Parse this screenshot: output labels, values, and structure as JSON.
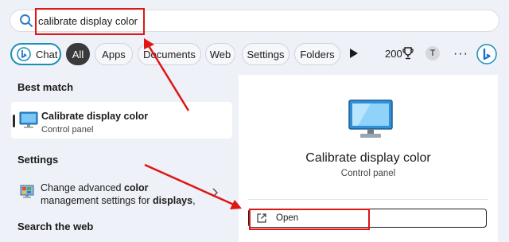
{
  "search": {
    "value": "calibrate display color"
  },
  "filters": {
    "chat": "Chat",
    "all": "All",
    "apps": "Apps",
    "documents": "Documents",
    "web": "Web",
    "settings": "Settings",
    "folders": "Folders"
  },
  "toolbar": {
    "rewards_count": "200",
    "avatar_initial": "T",
    "more_options": "···"
  },
  "left_panel": {
    "best_match_label": "Best match",
    "best_match": {
      "title": "Calibrate display color",
      "subtitle": "Control panel"
    },
    "settings_label": "Settings",
    "settings_item": {
      "text_1": "Change advanced ",
      "bold_1": "color",
      "text_2": " management settings for ",
      "bold_2": "displays",
      "text_3": ","
    },
    "search_web_label": "Search the web"
  },
  "detail": {
    "title": "Calibrate display color",
    "subtitle": "Control panel",
    "open_label": "Open"
  },
  "colors": {
    "accent": "#1a8fb5",
    "annotation_red": "#e01515",
    "panel_bg": "#eef1f7"
  },
  "icons": [
    "search-icon",
    "bing-chat-icon",
    "play-icon",
    "trophy-icon",
    "monitor-icon",
    "color-management-icon",
    "external-open-icon",
    "chevron-right-icon"
  ]
}
